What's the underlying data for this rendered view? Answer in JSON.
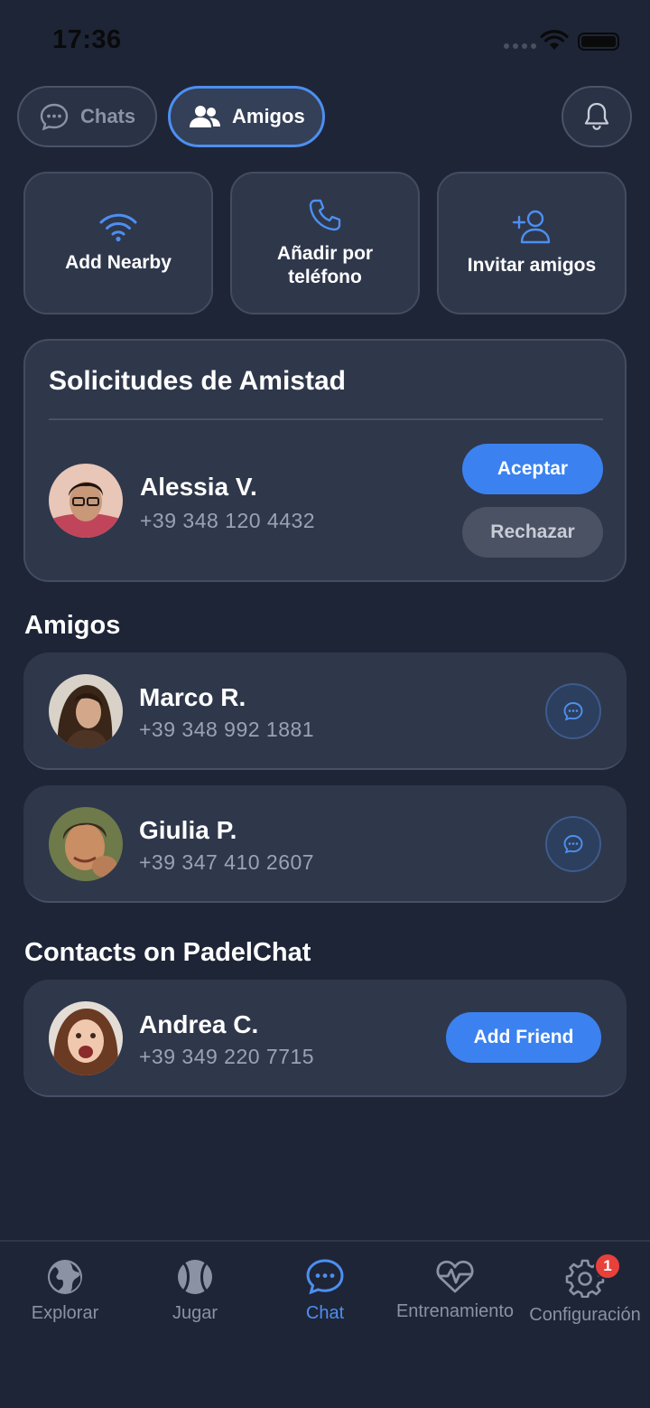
{
  "status_bar": {
    "time": "17:36"
  },
  "top_tabs": {
    "chats_label": "Chats",
    "amigos_label": "Amigos"
  },
  "actions": [
    {
      "label": "Add Nearby",
      "icon": "wifi-icon"
    },
    {
      "label": "Añadir por teléfono",
      "icon": "phone-icon"
    },
    {
      "label": "Invitar amigos",
      "icon": "add-user-icon"
    }
  ],
  "requests": {
    "title": "Solicitudes de Amistad",
    "items": [
      {
        "name": "Alessia V.",
        "phone": "+39 348 120 4432",
        "accept_label": "Aceptar",
        "reject_label": "Rechazar"
      }
    ]
  },
  "friends": {
    "title": "Amigos",
    "items": [
      {
        "name": "Marco R.",
        "phone": "+39 348 992 1881"
      },
      {
        "name": "Giulia P.",
        "phone": "+39 347 410 2607"
      }
    ]
  },
  "contacts": {
    "title": "Contacts on PadelChat",
    "items": [
      {
        "name": "Andrea C.",
        "phone": "+39 349 220 7715",
        "add_label": "Add Friend"
      }
    ]
  },
  "tabbar": {
    "items": [
      {
        "label": "Explorar",
        "icon": "globe-icon"
      },
      {
        "label": "Jugar",
        "icon": "tennis-ball-icon"
      },
      {
        "label": "Chat",
        "icon": "chat-bubble-icon",
        "active": true
      },
      {
        "label": "Entrenamiento",
        "icon": "heart-pulse-icon"
      },
      {
        "label": "Configuración",
        "icon": "gear-icon",
        "badge": "1"
      }
    ]
  },
  "colors": {
    "accent": "#3b82f0",
    "background": "#1e2537",
    "card": "#2f374b",
    "badge": "#e8403a"
  }
}
